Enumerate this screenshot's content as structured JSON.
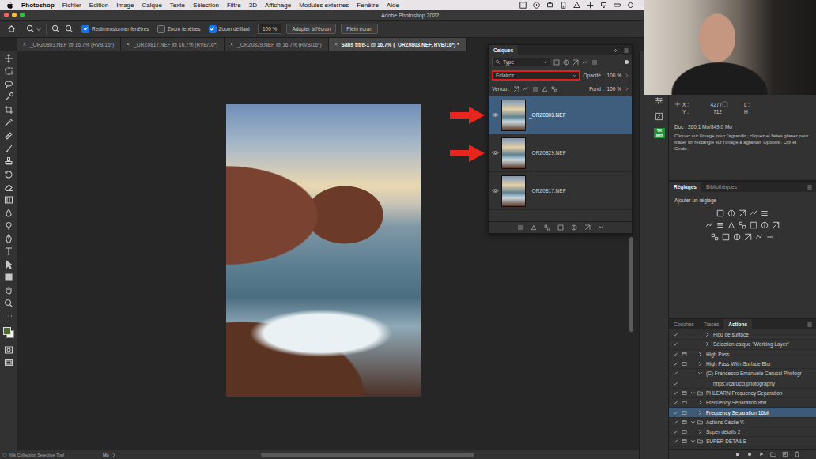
{
  "menu_bar": {
    "app": "Photoshop",
    "items": [
      "Fichier",
      "Edition",
      "Image",
      "Calque",
      "Texte",
      "Sélection",
      "Filtre",
      "3D",
      "Affichage",
      "Modules externes",
      "Fenêtre",
      "Aide"
    ]
  },
  "window": {
    "title": "Adobe Photoshop 2022"
  },
  "options_bar": {
    "checkboxes": [
      {
        "label": "Redimensionner fenêtres",
        "checked": true
      },
      {
        "label": "Zoom fenêtres",
        "checked": false
      },
      {
        "label": "Zoom défilant",
        "checked": true
      }
    ],
    "zoom": "100 %",
    "buttons": [
      "Adapter à l'écran",
      "Plein écran"
    ]
  },
  "tabs": [
    {
      "label": "_ORZ0803.NEF @ 16,7% (RVB/16*)",
      "selected": false
    },
    {
      "label": "_ORZ0817.NEF @ 16,7% (RVB/16*)",
      "selected": false
    },
    {
      "label": "_ORZ0829.NEF @ 16,7% (RVB/16*)",
      "selected": false
    },
    {
      "label": "Sans titre-1 @ 16,7% (_ORZ0803.NEF, RVB/16*) *",
      "selected": true
    }
  ],
  "layers_panel": {
    "title": "Calques",
    "filter": "Type",
    "blend_mode": "Eclaircir",
    "blend_highlighted": true,
    "opacity_label": "Opacité :",
    "opacity": "100 %",
    "lock_label": "Verrou :",
    "fill_label": "Fond :",
    "fill": "100 %",
    "layers": [
      {
        "name": "_ORZ0803.NEF",
        "visible": true,
        "selected": true,
        "marked": true
      },
      {
        "name": "_ORZ0829.NEF",
        "visible": true,
        "selected": false,
        "marked": true
      },
      {
        "name": "_ORZ0817.NEF",
        "visible": true,
        "selected": false,
        "marked": false
      }
    ]
  },
  "side_strip": {
    "badge": [
      "TK",
      "Mm"
    ]
  },
  "info_panel": {
    "x_label": "X :",
    "x": "4277",
    "y_label": "Y :",
    "y": "712",
    "w_label": "L :",
    "h_label": "H :",
    "doc": "Doc : 260,1 Mo/849,0 Mo",
    "help": "Cliquez sur l'image pour l'agrandir ; cliquez et faites glisser pour tracer un rectangle sur l'image à agrandir. Options : Opt et Cmde."
  },
  "adjustments_panel": {
    "tabs": [
      {
        "label": "Réglages",
        "selected": true
      },
      {
        "label": "Bibliothèques",
        "selected": false
      }
    ],
    "hint": "Ajouter un réglage"
  },
  "actions_panel": {
    "tabs": [
      {
        "label": "Couches",
        "selected": false
      },
      {
        "label": "Tracés",
        "selected": false
      },
      {
        "label": "Actions",
        "selected": true
      }
    ],
    "items": [
      {
        "label": "Flou de surface",
        "kind": "command",
        "depth": 2,
        "checked": true,
        "dialog": false,
        "expandable": true,
        "expanded": false,
        "selected": false
      },
      {
        "label": "Sélection calque \"Working Layer\"",
        "kind": "command",
        "depth": 2,
        "checked": true,
        "dialog": false,
        "expandable": true,
        "expanded": false,
        "selected": false
      },
      {
        "label": "High Pass",
        "kind": "action",
        "depth": 1,
        "checked": true,
        "dialog": true,
        "expandable": true,
        "expanded": false,
        "selected": false
      },
      {
        "label": "High Pass With Surface Blur",
        "kind": "action",
        "depth": 1,
        "checked": true,
        "dialog": true,
        "expandable": true,
        "expanded": false,
        "selected": false
      },
      {
        "label": "(C) Francesco Emanuele Carucci Photogr",
        "kind": "action",
        "depth": 1,
        "checked": true,
        "dialog": false,
        "expandable": true,
        "expanded": true,
        "selected": false
      },
      {
        "label": "https://carucci.photography",
        "kind": "command",
        "depth": 2,
        "checked": true,
        "dialog": false,
        "expandable": false,
        "expanded": false,
        "selected": false
      },
      {
        "label": "PHLEARN Frequency Separation",
        "kind": "set",
        "depth": 0,
        "checked": true,
        "dialog": true,
        "expandable": true,
        "expanded": true,
        "selected": false
      },
      {
        "label": "Frequency Separation 8bit",
        "kind": "action",
        "depth": 1,
        "checked": true,
        "dialog": true,
        "expandable": true,
        "expanded": false,
        "selected": false
      },
      {
        "label": "Frequency Separation 16bit",
        "kind": "action",
        "depth": 1,
        "checked": true,
        "dialog": true,
        "expandable": true,
        "expanded": false,
        "selected": true
      },
      {
        "label": "Actions Cécile V.",
        "kind": "set",
        "depth": 0,
        "checked": true,
        "dialog": true,
        "expandable": true,
        "expanded": true,
        "selected": false
      },
      {
        "label": "Super détails 2",
        "kind": "action",
        "depth": 1,
        "checked": true,
        "dialog": true,
        "expandable": true,
        "expanded": false,
        "selected": false
      },
      {
        "label": "SUPER DÉTAILS",
        "kind": "set",
        "depth": 0,
        "checked": true,
        "dialog": true,
        "expandable": true,
        "expanded": true,
        "selected": false
      }
    ]
  },
  "status_bar": {
    "tool": "Nik Collection Selective Tool",
    "info": "Mo"
  }
}
